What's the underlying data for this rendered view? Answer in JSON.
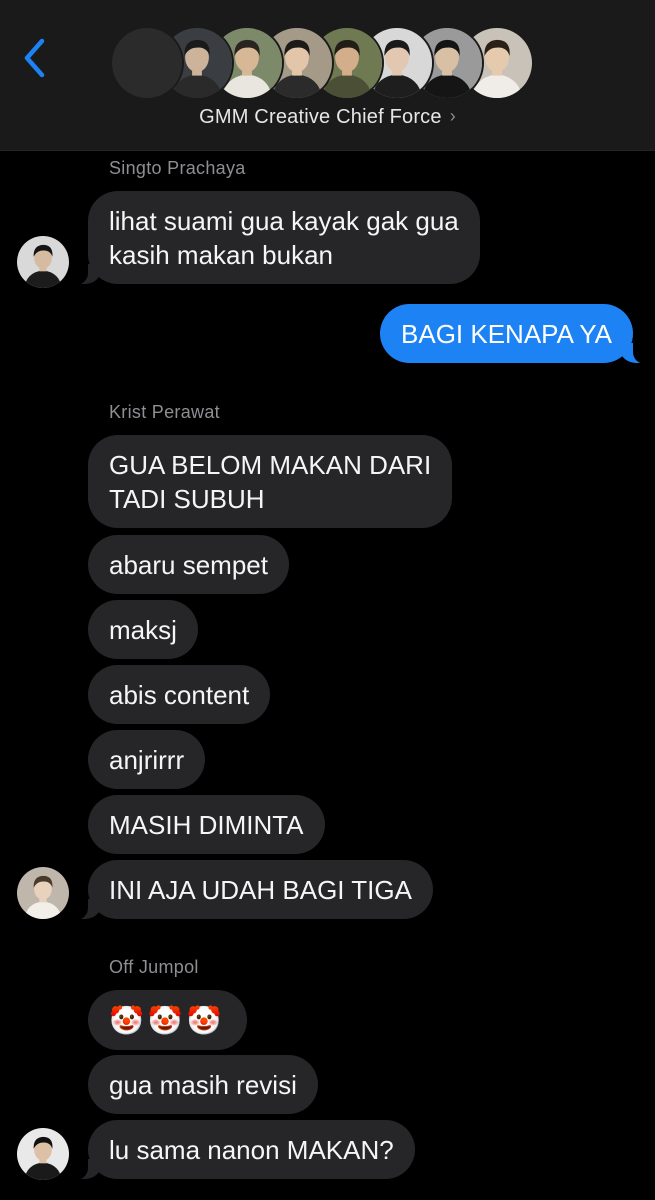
{
  "header": {
    "back_icon": "chevron-left-icon",
    "group_name": "GMM Creative Chief Force",
    "title_chevron": "›",
    "avatars": [
      {
        "icon": "group-avatar-placeholder",
        "bg": "#2b2b2b",
        "skin": "#2b2b2b",
        "shirt": "#2b2b2b",
        "hair": "#2b2b2b"
      },
      {
        "icon": "member-avatar-icon",
        "bg": "#3a3d42",
        "skin": "#cdb39a",
        "shirt": "#2a2a2a",
        "hair": "#1a1a1a"
      },
      {
        "icon": "member-avatar-icon",
        "bg": "#7c8a6a",
        "skin": "#d7b896",
        "shirt": "#e8e6de",
        "hair": "#2a2420"
      },
      {
        "icon": "member-avatar-icon",
        "bg": "#a59a88",
        "skin": "#e3c6aa",
        "shirt": "#2b2b2b",
        "hair": "#1d1a18"
      },
      {
        "icon": "member-avatar-icon",
        "bg": "#6f7a52",
        "skin": "#d2ae8a",
        "shirt": "#4a4f36",
        "hair": "#231d17"
      },
      {
        "icon": "member-avatar-icon",
        "bg": "#d8d8d8",
        "skin": "#e2c8b1",
        "shirt": "#1e1e1e",
        "hair": "#1a1a1a"
      },
      {
        "icon": "member-avatar-icon",
        "bg": "#9a9a9a",
        "skin": "#d9bfa4",
        "shirt": "#151515",
        "hair": "#141414"
      },
      {
        "icon": "member-avatar-icon",
        "bg": "#c9c2b8",
        "skin": "#e5caae",
        "shirt": "#f0ede8",
        "hair": "#2a2018"
      }
    ]
  },
  "conversation": [
    {
      "sender": "Singto Prachaya",
      "avatar": {
        "icon": "singto-avatar-icon",
        "bg": "#d9d9d9",
        "skin": "#d6bba0",
        "shirt": "#1c1c1c",
        "hair": "#151515"
      },
      "messages": [
        "lihat suami gua kayak gak gua\nkasih makan bukan"
      ]
    },
    {
      "sender": "Me",
      "outgoing": true,
      "messages": [
        "BAGI KENAPA YA"
      ]
    },
    {
      "sender": "Krist Perawat",
      "avatar": {
        "icon": "krist-avatar-icon",
        "bg": "#bfb7ab",
        "skin": "#e8d2bd",
        "shirt": "#f2efe9",
        "hair": "#4a3a2c"
      },
      "messages": [
        "GUA BELOM MAKAN DARI\nTADI SUBUH",
        "abaru sempet",
        "maksj",
        "abis content",
        "anjrirrr",
        "MASIH DIMINTA",
        "INI AJA UDAH BAGI TIGA"
      ]
    },
    {
      "sender": "Off Jumpol",
      "avatar": {
        "icon": "off-avatar-icon",
        "bg": "#e9e9e9",
        "skin": "#dcc1a6",
        "shirt": "#1a1a1a",
        "hair": "#111111"
      },
      "messages": [
        "🤡🤡🤡",
        "gua masih revisi",
        "lu sama nanon MAKAN?"
      ]
    }
  ],
  "colors": {
    "background": "#000000",
    "header_bg": "#1a1a1a",
    "incoming_bubble": "#262629",
    "outgoing_bubble": "#1d83f5",
    "accent": "#1d83f5",
    "sender_label": "#8e8e93"
  }
}
